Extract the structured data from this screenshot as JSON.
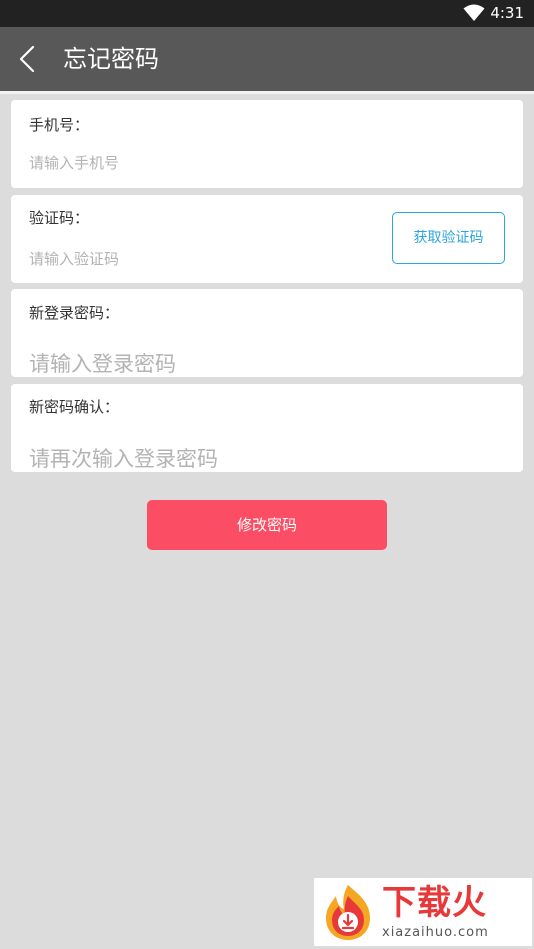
{
  "status_bar": {
    "time": "4:31"
  },
  "app_bar": {
    "title": "忘记密码"
  },
  "form": {
    "phone": {
      "label": "手机号：",
      "placeholder": "请输入手机号"
    },
    "code": {
      "label": "验证码：",
      "placeholder": "请输入验证码",
      "button": "获取验证码"
    },
    "new_password": {
      "label": "新登录密码：",
      "placeholder": "请输入登录密码"
    },
    "confirm_password": {
      "label": "新密码确认：",
      "placeholder": "请再次输入登录密码"
    }
  },
  "submit": {
    "label": "修改密码"
  },
  "watermark": {
    "main": "下载火",
    "sub": "xiazaihuo.com"
  },
  "colors": {
    "status_bar": "#222222",
    "app_bar": "#585858",
    "background": "#dcdcdc",
    "accent_blue": "#2aa5de",
    "submit": "#fb4d63",
    "watermark_red": "#e8393a"
  },
  "icons": {
    "status": "wifi-icon",
    "back": "back-arrow-icon",
    "watermark": "fire-download-icon"
  }
}
